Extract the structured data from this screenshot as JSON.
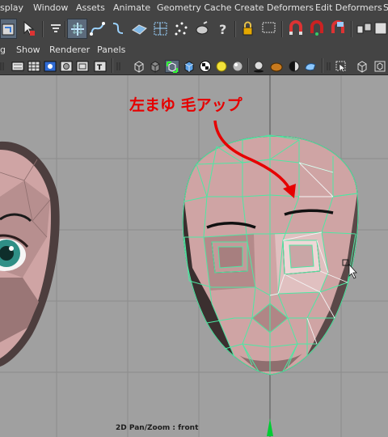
{
  "menubar": {
    "items": [
      "splay",
      "Window",
      "Assets",
      "Animate",
      "Geometry Cache",
      "Create Deformers",
      "Edit Deformers",
      "S"
    ]
  },
  "panel_menu": {
    "items": [
      "g",
      "Show",
      "Renderer",
      "Panels"
    ]
  },
  "viewport": {
    "annotation": "左まゆ 毛アップ",
    "camera_label": "2D Pan/Zoom : front"
  },
  "colors": {
    "ui_background": "#444444",
    "menu_text": "#e2e2e2",
    "viewport_background": "#a0a0a0",
    "grid_line": "#8c8c8c",
    "wireframe": "#4de8a3",
    "skin": "#cfa4a4",
    "annotation_red": "#e60000",
    "view_axis_green": "#00cc33"
  }
}
